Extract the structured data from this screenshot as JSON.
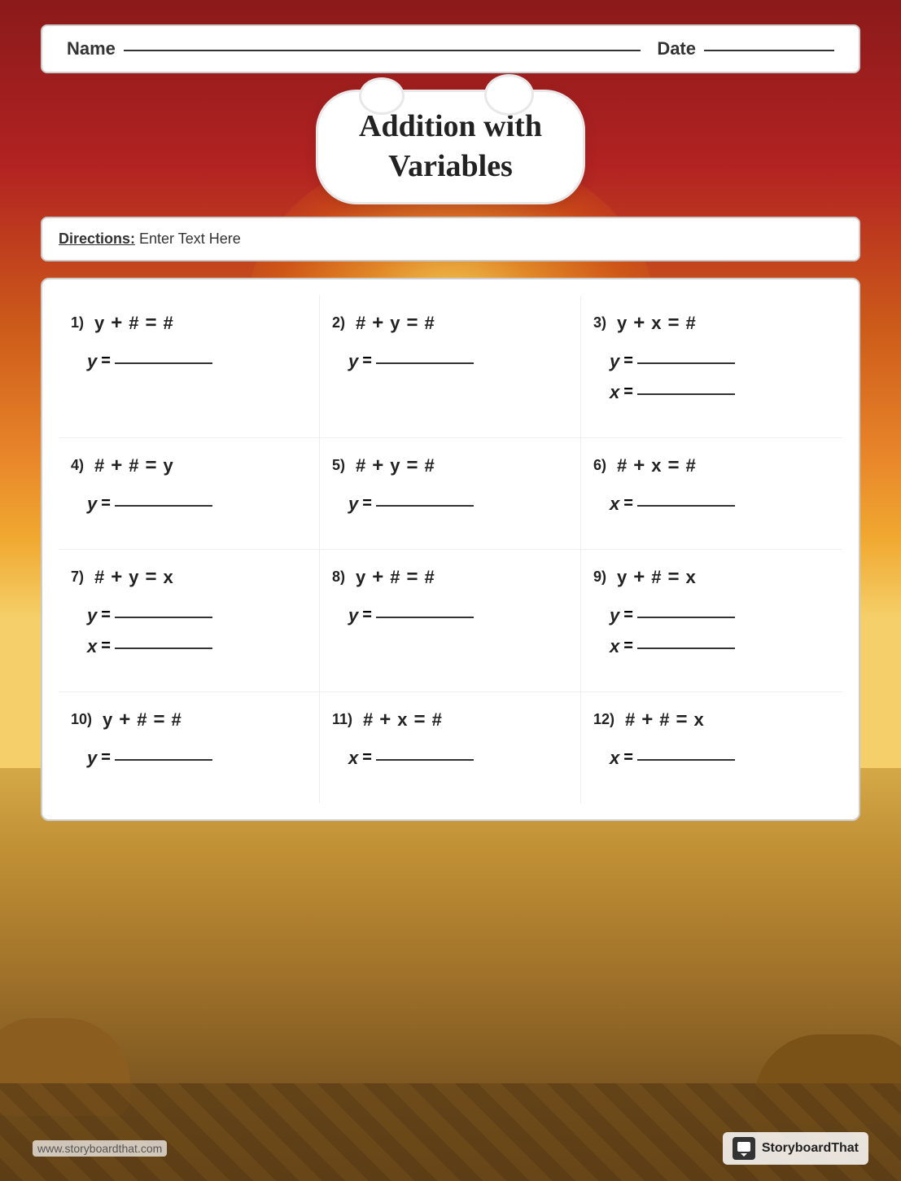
{
  "header": {
    "name_label": "Name",
    "date_label": "Date"
  },
  "title": {
    "line1": "Addition with",
    "line2": "Variables"
  },
  "directions": {
    "label": "Directions:",
    "text": " Enter Text Here"
  },
  "problems": [
    {
      "num": "1)",
      "equation": "y + # = #",
      "parts": [
        {
          "var": "y",
          "eq": "="
        }
      ]
    },
    {
      "num": "2)",
      "equation": "# + y = #",
      "parts": [
        {
          "var": "y",
          "eq": "="
        }
      ]
    },
    {
      "num": "3)",
      "equation": "y + x = #",
      "parts": [
        {
          "var": "y",
          "eq": "="
        },
        {
          "var": "x",
          "eq": "="
        }
      ]
    },
    {
      "num": "4)",
      "equation": "# + # = y",
      "parts": [
        {
          "var": "y",
          "eq": "="
        }
      ]
    },
    {
      "num": "5)",
      "equation": "# + y = #",
      "parts": [
        {
          "var": "y",
          "eq": "="
        }
      ]
    },
    {
      "num": "6)",
      "equation": "# + x = #",
      "parts": [
        {
          "var": "x",
          "eq": "="
        }
      ]
    },
    {
      "num": "7)",
      "equation": "# + y = x",
      "parts": [
        {
          "var": "y",
          "eq": "="
        },
        {
          "var": "x",
          "eq": "="
        }
      ]
    },
    {
      "num": "8)",
      "equation": "y + # = #",
      "parts": [
        {
          "var": "y",
          "eq": "="
        }
      ]
    },
    {
      "num": "9)",
      "equation": "y + # = x",
      "parts": [
        {
          "var": "y",
          "eq": "="
        },
        {
          "var": "x",
          "eq": "="
        }
      ]
    },
    {
      "num": "10)",
      "equation": "y + # = #",
      "parts": [
        {
          "var": "y",
          "eq": "="
        }
      ]
    },
    {
      "num": "11)",
      "equation": "# + x = #",
      "parts": [
        {
          "var": "x",
          "eq": "="
        }
      ]
    },
    {
      "num": "12)",
      "equation": "# + # = x",
      "parts": [
        {
          "var": "x",
          "eq": "="
        }
      ]
    }
  ],
  "footer": {
    "url": "www.storyboardthat.com",
    "brand": "StoryboardThat"
  }
}
